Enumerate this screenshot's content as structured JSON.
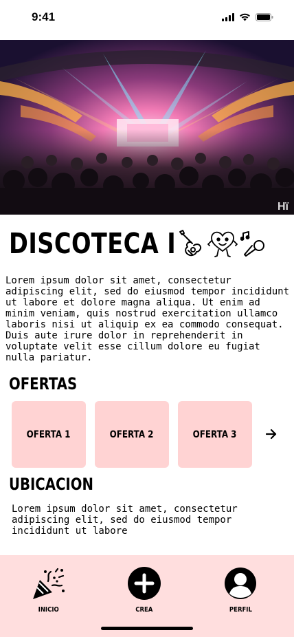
{
  "status_bar": {
    "time": "9:41",
    "icons": [
      "signal-icon",
      "wifi-icon",
      "battery-icon"
    ]
  },
  "hero": {
    "image": "nightclub-crowd-photo",
    "watermark": "Hï"
  },
  "venue": {
    "title": "DISCOTECA I",
    "genre_icons": [
      "guitar-icon",
      "heart-character-icon",
      "microphone-music-icon"
    ],
    "description": "Lorem ipsum dolor sit amet, consectetur adipiscing elit, sed do eiusmod tempor incididunt ut labore et dolore magna aliqua. Ut enim ad minim veniam, quis nostrud exercitation ullamco laboris nisi ut aliquip ex ea commodo consequat. Duis aute irure dolor in reprehenderit in voluptate velit esse cillum dolore eu fugiat nulla pariatur."
  },
  "offers": {
    "title": "OFERTAS",
    "items": [
      {
        "label": "OFERTA 1"
      },
      {
        "label": "OFERTA 2"
      },
      {
        "label": "OFERTA 3"
      }
    ],
    "next_icon": "arrow-right-icon"
  },
  "location": {
    "title": "UBICACION",
    "text": "Lorem ipsum dolor sit amet, consectetur adipiscing elit, sed do eiusmod tempor incididunt ut labore"
  },
  "bottom_nav": {
    "items": [
      {
        "label": "INICIO",
        "icon": "party-popper-icon"
      },
      {
        "label": "CREA",
        "icon": "plus-circle-icon"
      },
      {
        "label": "PERFIL",
        "icon": "user-avatar-icon"
      }
    ]
  },
  "colors": {
    "card_pink": "#ffd3d3",
    "nav_pink": "#ffdede",
    "text": "#000000"
  }
}
